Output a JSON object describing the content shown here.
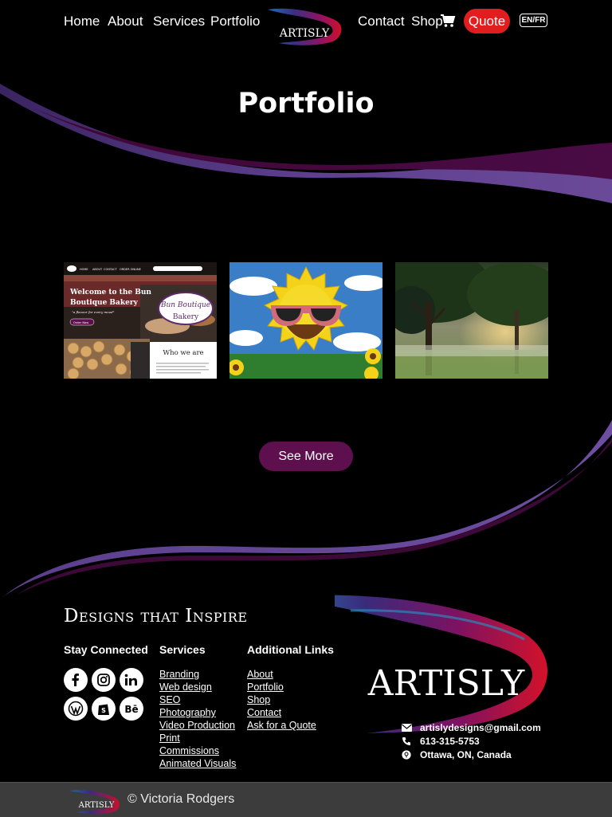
{
  "nav": {
    "left_links": [
      "Home",
      "About",
      "Services",
      "Portfolio"
    ],
    "right_links": [
      "Contact",
      "Shop"
    ],
    "quote_label": "Quote",
    "language_label": "EN/FR",
    "logo_text": "ARTISLY",
    "cart_icon": "cart-icon"
  },
  "hero": {
    "title": "Portfolio"
  },
  "gallery": {
    "bakery": {
      "site_nav": [
        "HOME",
        "ABOUT",
        "CONTACT",
        "ORDER ONLINE"
      ],
      "heading_line1": "Welcome to the Bun",
      "heading_line2": "Boutique Bakery",
      "tagline": "\"a flavour for every mood\"",
      "cta": "Order Now",
      "logo_script": "Bun Boutique",
      "logo_word": "Bakery",
      "section_title": "Who we are"
    },
    "see_more_label": "See More"
  },
  "footer": {
    "tagline": "Designs that Inspire",
    "columns": {
      "stay_connected": "Stay Connected",
      "services": "Services",
      "additional": "Additional Links"
    },
    "social_icons": [
      "facebook-icon",
      "instagram-icon",
      "linkedin-icon",
      "wordpress-icon",
      "shopify-icon",
      "behance-icon"
    ],
    "services_links": [
      "Branding",
      "Web design",
      "SEO",
      "Photography",
      "Video Production",
      "Print",
      "Commissions",
      "Animated Visuals"
    ],
    "additional_links": [
      "About",
      "Portfolio",
      "Shop",
      "Contact",
      "Ask for a Quote"
    ],
    "logo_text": "ARTISLY",
    "contact": {
      "email": "artislydesigns@gmail.com",
      "phone": "613-315-5753",
      "location": "Ottawa, ON, Canada"
    },
    "copyright": "© Victoria Rodgers"
  },
  "colors": {
    "background": "#000000",
    "quote_red": "#e01e1e",
    "button_purple": "#5e0f4e",
    "swoosh_purple": "#5b3a86",
    "bottom_bar": "#3c3c3c"
  }
}
